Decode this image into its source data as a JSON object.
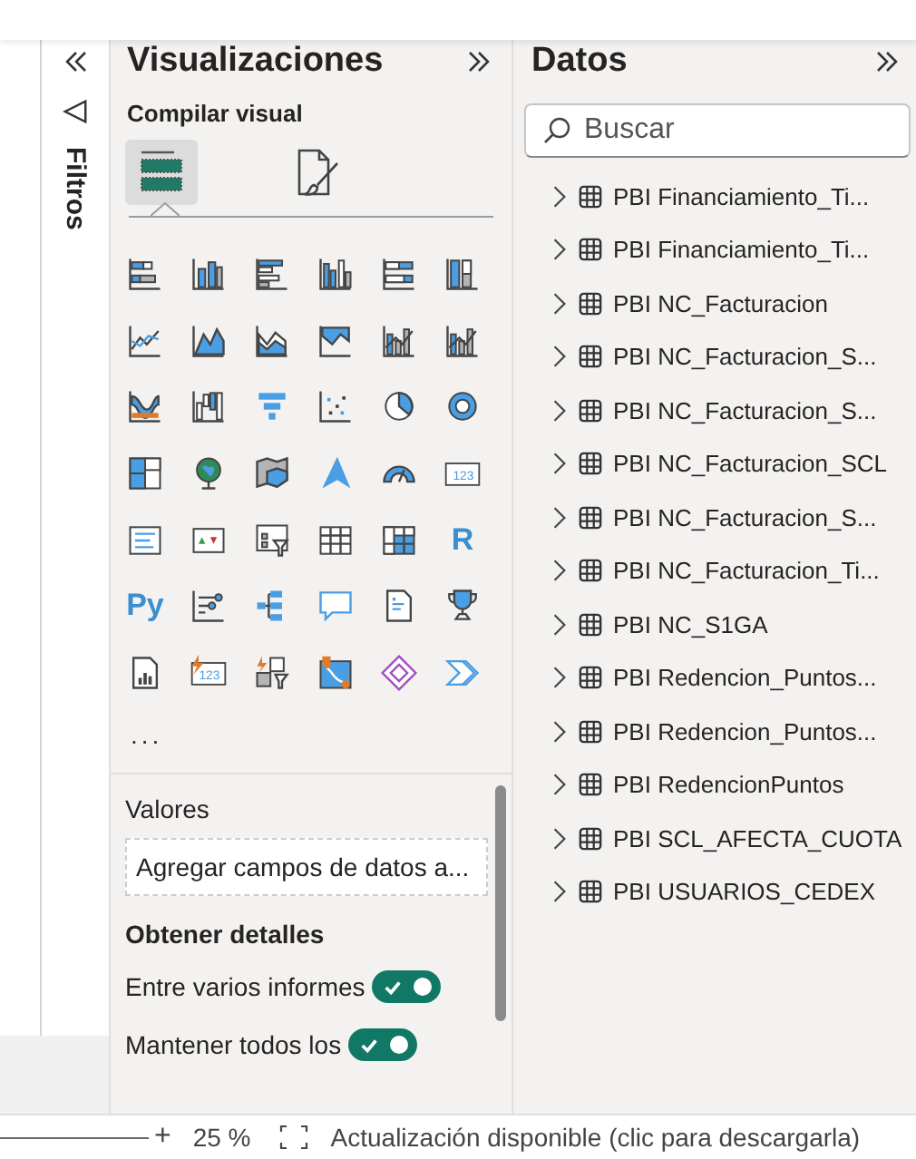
{
  "filters": {
    "title": "Filtros"
  },
  "visualizations": {
    "title": "Visualizaciones",
    "subtitle": "Compilar visual",
    "tabs": [
      {
        "kind": "build",
        "selected": true
      },
      {
        "kind": "format",
        "selected": false
      }
    ],
    "visuals": [
      {
        "kind": "hbar-stacked"
      },
      {
        "kind": "col-stacked"
      },
      {
        "kind": "hbar-clustered"
      },
      {
        "kind": "col-clustered"
      },
      {
        "kind": "hbar-100"
      },
      {
        "kind": "col-100"
      },
      {
        "kind": "line"
      },
      {
        "kind": "area"
      },
      {
        "kind": "area-stacked"
      },
      {
        "kind": "area-top"
      },
      {
        "kind": "line-col"
      },
      {
        "kind": "line-col"
      },
      {
        "kind": "ribbon"
      },
      {
        "kind": "waterfall"
      },
      {
        "kind": "funnel"
      },
      {
        "kind": "scatter"
      },
      {
        "kind": "pie"
      },
      {
        "kind": "donut"
      },
      {
        "kind": "treemap"
      },
      {
        "kind": "globe"
      },
      {
        "kind": "filled-map"
      },
      {
        "kind": "arrow"
      },
      {
        "kind": "gauge"
      },
      {
        "kind": "card",
        "label": "123"
      },
      {
        "kind": "multirow"
      },
      {
        "kind": "kpi"
      },
      {
        "kind": "slicer"
      },
      {
        "kind": "table"
      },
      {
        "kind": "matrix"
      },
      {
        "kind": "letter",
        "label": "R"
      },
      {
        "kind": "letter",
        "label": "Py"
      },
      {
        "kind": "influencers"
      },
      {
        "kind": "decomp"
      },
      {
        "kind": "bubble"
      },
      {
        "kind": "narrative"
      },
      {
        "kind": "trophy"
      },
      {
        "kind": "paginated"
      },
      {
        "kind": "card-bolt",
        "label": "123"
      },
      {
        "kind": "slicer-bolt"
      },
      {
        "kind": "map-pin"
      },
      {
        "kind": "diamond"
      },
      {
        "kind": "automate"
      }
    ],
    "more": "...",
    "well_label": "Valores",
    "well_placeholder": "Agregar campos de datos a...",
    "details_title": "Obtener detalles",
    "toggles": [
      {
        "label": "Entre varios informes",
        "on": true
      },
      {
        "label": "Mantener todos los",
        "on": true
      }
    ]
  },
  "data": {
    "title": "Datos",
    "search": {
      "placeholder": "Buscar"
    },
    "tables": [
      "PBI Financiamiento_Ti...",
      "PBI Financiamiento_Ti...",
      "PBI NC_Facturacion",
      "PBI NC_Facturacion_S...",
      "PBI NC_Facturacion_S...",
      "PBI NC_Facturacion_SCL",
      "PBI NC_Facturacion_S...",
      "PBI NC_Facturacion_Ti...",
      "PBI NC_S1GA",
      "PBI Redencion_Puntos...",
      "PBI Redencion_Puntos...",
      "PBI RedencionPuntos",
      "PBI SCL_AFECTA_CUOTA",
      "PBI USUARIOS_CEDEX"
    ]
  },
  "status_bar": {
    "zoom_in": "+",
    "zoom": "25 %",
    "message": "Actualización disponible (clic para descargarla)"
  }
}
